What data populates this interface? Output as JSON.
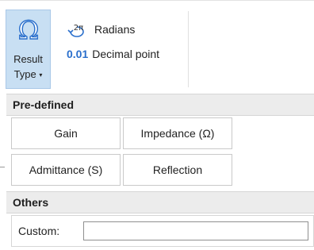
{
  "ribbon": {
    "result_type_label_line1": "Result",
    "result_type_label_line2": "Type",
    "caret": "▾",
    "angle_unit_icon": "2π",
    "angle_unit_label": "Radians",
    "decimal_icon": "0.01",
    "decimal_label": "Decimal point"
  },
  "dropdown": {
    "predefined_header": "Pre-defined",
    "options": [
      "Gain",
      "Impedance (Ω)",
      "Admittance (S)",
      "Reflection"
    ],
    "others_header": "Others",
    "custom_label": "Custom:",
    "custom_value": ""
  },
  "colors": {
    "selected_button_bg": "#c8dff3",
    "icon_blue": "#2a6fcc"
  }
}
